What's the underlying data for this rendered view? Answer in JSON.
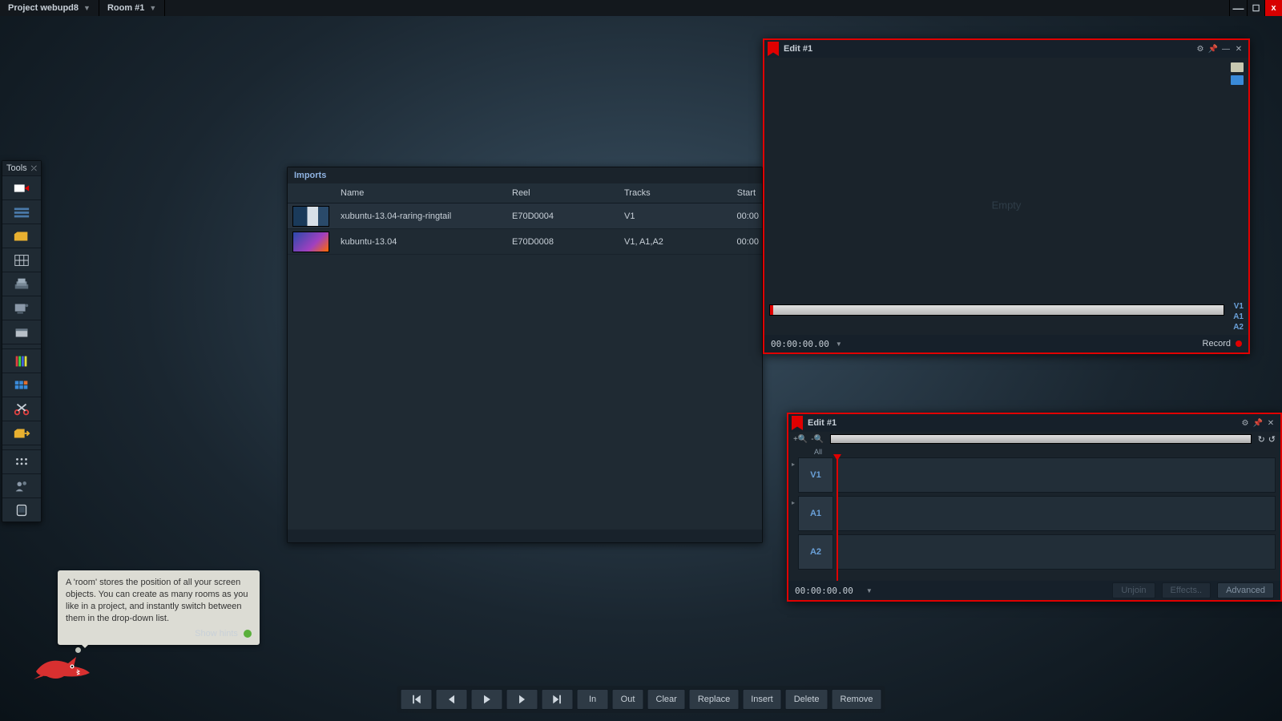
{
  "menubar": {
    "project_label": "Project webupd8",
    "room_label": "Room #1"
  },
  "tools": {
    "title": "Tools",
    "items": [
      "import-tool",
      "timeline-tool",
      "bin-tool",
      "grid-tool",
      "layers-tool",
      "output-tool",
      "disk-tool",
      "gap1",
      "scopes-tool",
      "keypad-tool",
      "cut-tool",
      "export-tool",
      "gap2",
      "apps-tool",
      "users-tool",
      "device-tool"
    ]
  },
  "imports": {
    "title": "Imports",
    "columns": {
      "name": "Name",
      "reel": "Reel",
      "tracks": "Tracks",
      "start": "Start"
    },
    "rows": [
      {
        "name": "xubuntu-13.04-raring-ringtail",
        "reel": "E70D0004",
        "tracks": "V1",
        "start": "00:00"
      },
      {
        "name": "kubuntu-13.04",
        "reel": "E70D0008",
        "tracks": "V1, A1,A2",
        "start": "00:00"
      }
    ]
  },
  "edit_viewer": {
    "title": "Edit #1",
    "empty_text": "Empty",
    "track_labels": [
      "V1",
      "A1",
      "A2"
    ],
    "timecode": "00:00:00.00",
    "record_label": "Record"
  },
  "edit_timeline": {
    "title": "Edit #1",
    "all_label": "All",
    "tracks": [
      "V1",
      "A1",
      "A2"
    ],
    "timecode": "00:00:00.00",
    "buttons": {
      "unjoin": "Unjoin",
      "effects": "Effects..",
      "advanced": "Advanced"
    }
  },
  "transport": {
    "in": "In",
    "out": "Out",
    "clear": "Clear",
    "replace": "Replace",
    "insert": "Insert",
    "delete": "Delete",
    "remove": "Remove"
  },
  "hint": {
    "text": "A 'room' stores the position of all your screen objects.  You can create as many rooms as you like in a project, and instantly switch between them in the drop-down list.",
    "show_label": "Show hints"
  },
  "colors": {
    "accent": "#e00000",
    "link": "#6aa0d8"
  }
}
